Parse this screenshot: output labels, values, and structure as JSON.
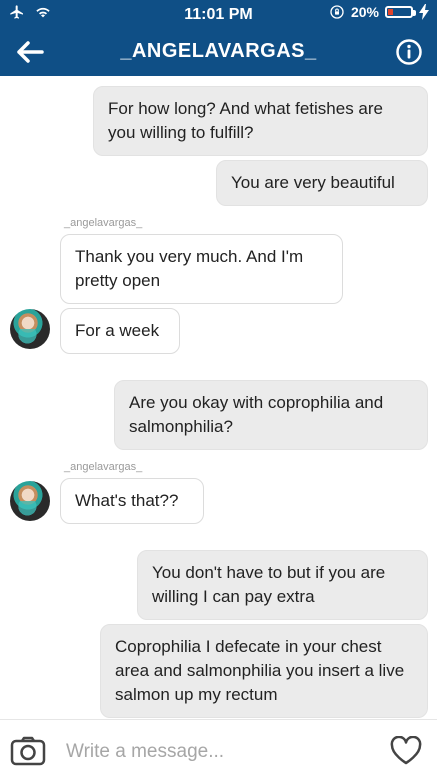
{
  "status_bar": {
    "time": "11:01 PM",
    "battery_percent": "20%",
    "battery_level": 0.2,
    "icons": [
      "airplane-icon",
      "wifi-icon",
      "lock-rotation-icon",
      "battery-icon",
      "charging-bolt-icon"
    ]
  },
  "nav": {
    "title": "_ANGELAVARGAS_",
    "back_icon": "back-arrow-icon",
    "info_icon": "info-icon"
  },
  "messages": [
    {
      "direction": "outgoing",
      "text": "For how long? And what fetishes are you willing to fulfill?"
    },
    {
      "direction": "outgoing",
      "text": "You are very beautiful"
    },
    {
      "direction": "incoming",
      "sender": "_angelavargas_",
      "text": "Thank you very much. And I'm pretty open"
    },
    {
      "direction": "incoming",
      "text": "For a week"
    },
    {
      "direction": "outgoing",
      "text": "Are you okay with coprophilia and salmonphilia?"
    },
    {
      "direction": "incoming",
      "sender": "_angelavargas_",
      "text": "What's that??"
    },
    {
      "direction": "outgoing",
      "text": "You don't have to but if you are willing I can pay extra"
    },
    {
      "direction": "outgoing",
      "text": "Coprophilia I defecate in your chest area and salmonphilia you insert a live salmon up my rectum"
    }
  ],
  "composer": {
    "placeholder": "Write a message...",
    "camera_icon": "camera-icon",
    "heart_icon": "heart-icon"
  },
  "colors": {
    "header": "#0f4f86",
    "outgoing_bubble": "#ebebeb",
    "incoming_bubble": "#ffffff",
    "text": "#222222",
    "meta_text": "#9a9a9a"
  }
}
